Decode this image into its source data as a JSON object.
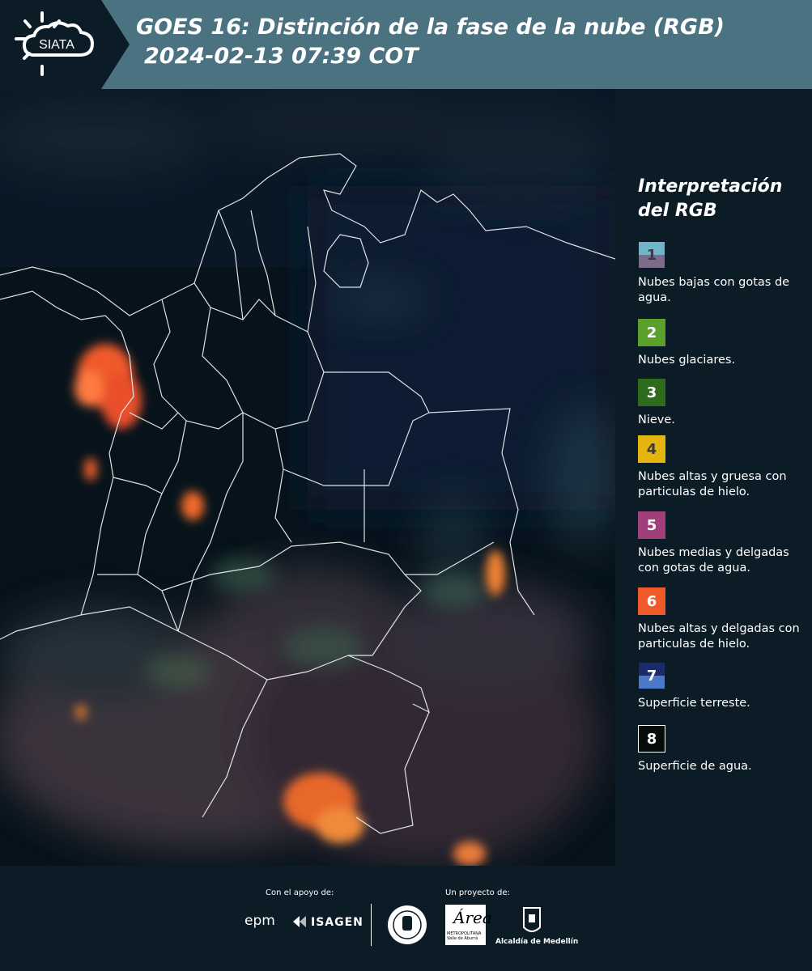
{
  "header": {
    "logo_text": "SIATA",
    "title_line1": "GOES 16: Distinción de la fase de la nube (RGB)",
    "title_line2": "2024-02-13 07:39 COT"
  },
  "legend": {
    "title_line1": "Interpretación",
    "title_line2": "del RGB",
    "items": [
      {
        "num": "1",
        "label": "Nubes bajas con gotas de agua.",
        "color": "#6fb6c7",
        "color2": "#7b6d8a",
        "num_color": "#3a3a4a"
      },
      {
        "num": "2",
        "label": "Nubes glaciares.",
        "color": "#5aa02c",
        "num_color": "#ffffff"
      },
      {
        "num": "3",
        "label": "Nieve.",
        "color": "#2e6b1d",
        "num_color": "#ffffff"
      },
      {
        "num": "4",
        "label": "Nubes altas y gruesa con particulas de hielo.",
        "color": "#e5b50f",
        "num_color": "#3a3a3a"
      },
      {
        "num": "5",
        "label": "Nubes medias y delgadas con gotas de agua.",
        "color": "#a13f7a",
        "num_color": "#ffffff"
      },
      {
        "num": "6",
        "label": "Nubes altas y delgadas con particulas de hielo.",
        "color": "#f05a2a",
        "num_color": "#ffffff"
      },
      {
        "num": "7",
        "label": "Superficie terreste.",
        "color": "#1a2a6c",
        "color2": "#4c78c8",
        "num_color": "#ffffff"
      },
      {
        "num": "8",
        "label": "Superficie de agua.",
        "color": "#050d08",
        "border": "#ffffff",
        "num_color": "#ffffff"
      }
    ]
  },
  "footer": {
    "support_label": "Con el apoyo de:",
    "project_label": "Un proyecto de:",
    "epm": "epm",
    "isagen": "ISAGEN",
    "area_logo": "Área",
    "area_sub": "METROPOLITANA Valle de Aburrá",
    "alcaldia": "Alcaldía de Medellín"
  }
}
